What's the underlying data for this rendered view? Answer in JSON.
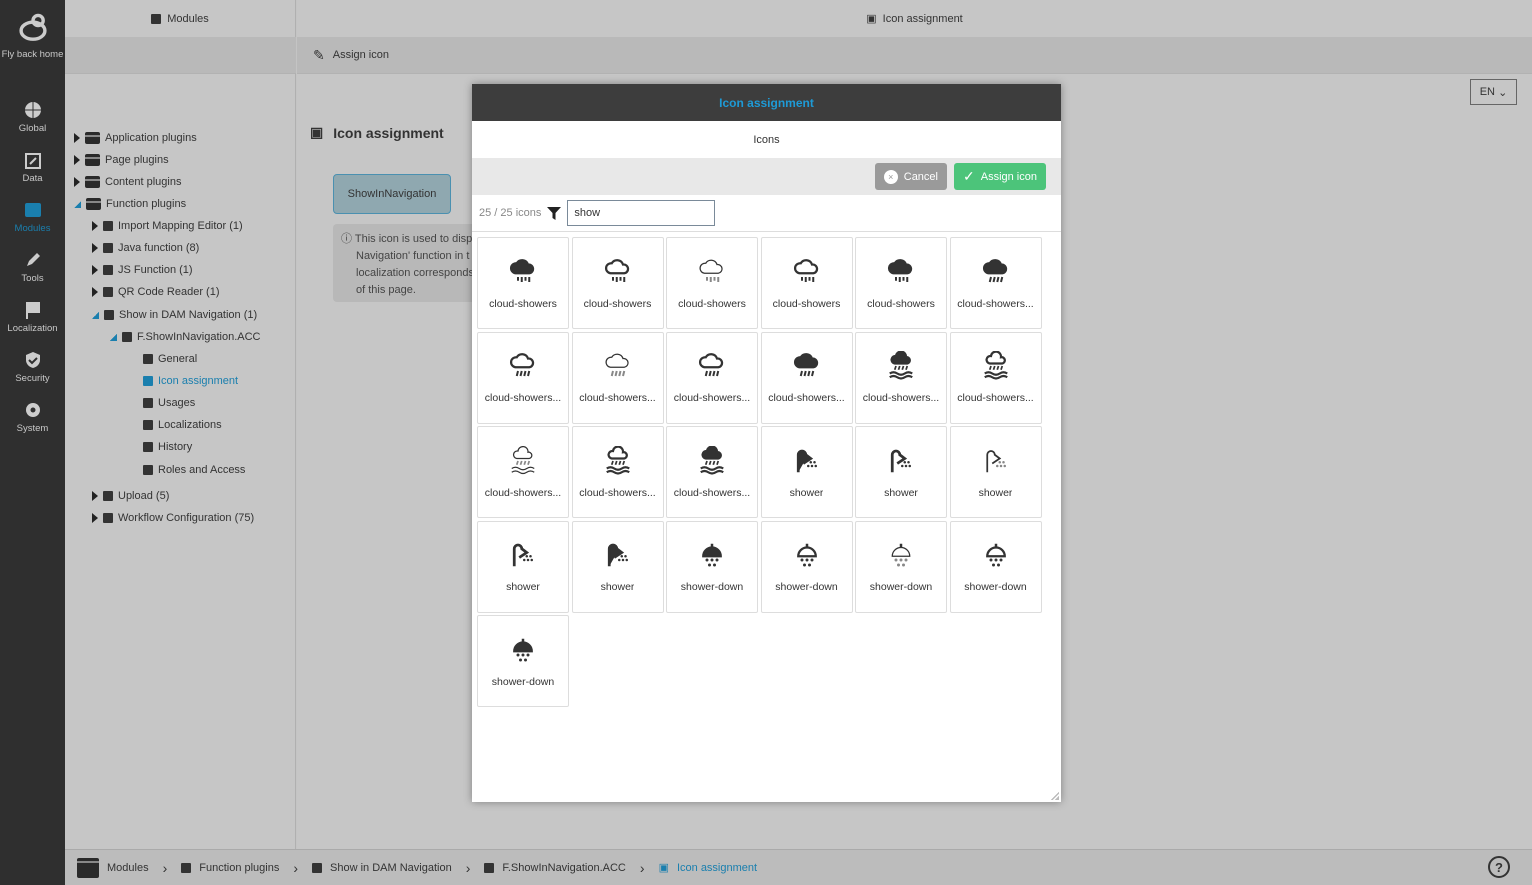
{
  "sidebar": {
    "items": [
      {
        "label": "Fly back home",
        "icon": "bee-icon"
      },
      {
        "label": "Global",
        "icon": "globe-icon"
      },
      {
        "label": "Data",
        "icon": "calendar-edit-icon"
      },
      {
        "label": "Modules",
        "icon": "window-icon",
        "active": true
      },
      {
        "label": "Tools",
        "icon": "pencil-icon"
      },
      {
        "label": "Localization",
        "icon": "flag-icon"
      },
      {
        "label": "Security",
        "icon": "shield-check-icon"
      },
      {
        "label": "System",
        "icon": "gear-wrench-icon"
      }
    ]
  },
  "tree": {
    "title": "Modules",
    "items": [
      {
        "label": "Application plugins"
      },
      {
        "label": "Page plugins"
      },
      {
        "label": "Content plugins"
      },
      {
        "label": "Function plugins"
      },
      {
        "label": "Import Mapping Editor (1)"
      },
      {
        "label": "Java function (8)"
      },
      {
        "label": "JS Function (1)"
      },
      {
        "label": "QR Code Reader (1)"
      },
      {
        "label": "Show in DAM Navigation (1)"
      },
      {
        "label": "F.ShowInNavigation.ACC"
      },
      {
        "label": "General"
      },
      {
        "label": "Icon assignment"
      },
      {
        "label": "Usages"
      },
      {
        "label": "Localizations"
      },
      {
        "label": "History"
      },
      {
        "label": "Roles and Access"
      },
      {
        "label": "Upload (5)"
      },
      {
        "label": "Workflow Configuration (75)"
      }
    ]
  },
  "main": {
    "header": "Icon assignment",
    "toolbar_action": "Assign icon",
    "page_title": "Icon assignment",
    "current_icon": "ShowInNavigation",
    "info": "This icon is used to disp Navigation' function in t localization corresponds of this page.",
    "info_lines": [
      "This icon is used to disp",
      "Navigation' function in t",
      "localization corresponds",
      "of this page."
    ],
    "language": "EN"
  },
  "modal": {
    "title": "Icon assignment",
    "subtitle": "Icons",
    "cancel": "Cancel",
    "assign": "Assign icon",
    "count": "25 / 25 icons",
    "search_value": "show",
    "icons": [
      {
        "label": "cloud-showers",
        "type": "cloud",
        "style": "solid"
      },
      {
        "label": "cloud-showers",
        "type": "cloud",
        "style": "outline"
      },
      {
        "label": "cloud-showers",
        "type": "cloud",
        "style": "light"
      },
      {
        "label": "cloud-showers",
        "type": "cloud",
        "style": "outline"
      },
      {
        "label": "cloud-showers",
        "type": "cloud",
        "style": "solid"
      },
      {
        "label": "cloud-showers...",
        "type": "cloud-slant",
        "style": "solid"
      },
      {
        "label": "cloud-showers...",
        "type": "cloud-slant",
        "style": "outline"
      },
      {
        "label": "cloud-showers...",
        "type": "cloud-slant",
        "style": "light"
      },
      {
        "label": "cloud-showers...",
        "type": "cloud-slant",
        "style": "outline"
      },
      {
        "label": "cloud-showers...",
        "type": "cloud-slant",
        "style": "solid"
      },
      {
        "label": "cloud-showers...",
        "type": "cloud-water",
        "style": "solid"
      },
      {
        "label": "cloud-showers...",
        "type": "cloud-water",
        "style": "outline"
      },
      {
        "label": "cloud-showers...",
        "type": "cloud-water",
        "style": "light"
      },
      {
        "label": "cloud-showers...",
        "type": "cloud-water",
        "style": "outline"
      },
      {
        "label": "cloud-showers...",
        "type": "cloud-water",
        "style": "solid"
      },
      {
        "label": "shower",
        "type": "shower",
        "style": "solid"
      },
      {
        "label": "shower",
        "type": "shower",
        "style": "outline"
      },
      {
        "label": "shower",
        "type": "shower",
        "style": "light"
      },
      {
        "label": "shower",
        "type": "shower",
        "style": "outline"
      },
      {
        "label": "shower",
        "type": "shower",
        "style": "solid"
      },
      {
        "label": "shower-down",
        "type": "shower-down",
        "style": "solid"
      },
      {
        "label": "shower-down",
        "type": "shower-down",
        "style": "outline"
      },
      {
        "label": "shower-down",
        "type": "shower-down",
        "style": "light"
      },
      {
        "label": "shower-down",
        "type": "shower-down",
        "style": "outline"
      },
      {
        "label": "shower-down",
        "type": "shower-down",
        "style": "solid"
      }
    ]
  },
  "breadcrumb": [
    "Modules",
    "Function plugins",
    "Show in DAM Navigation",
    "F.ShowInNavigation.ACC",
    "Icon assignment"
  ],
  "colors": {
    "accent": "#1e9ad6",
    "assign": "#4cc47a",
    "cancel": "#9a9a9a",
    "modal_header": "#3d3d3d"
  }
}
